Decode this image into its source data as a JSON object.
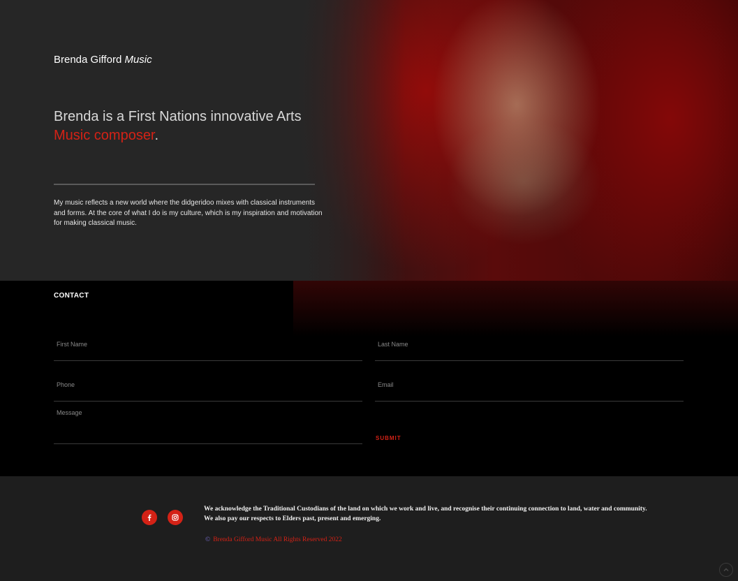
{
  "hero": {
    "brand_name": "Brenda Gifford",
    "brand_suffix": "Music",
    "headline_main": "Brenda is a First Nations innovative Arts",
    "headline_accent": "Music composer",
    "headline_end": ".",
    "intro": "My music reflects a new world where the didgeridoo mixes with classical instruments and forms. At the core of what I do is my culture, which is my inspiration and motivation for making classical music."
  },
  "contact": {
    "title": "CONTACT",
    "fields": {
      "first_name": {
        "placeholder": "First Name",
        "value": ""
      },
      "last_name": {
        "placeholder": "Last Name",
        "value": ""
      },
      "phone": {
        "placeholder": "Phone",
        "value": ""
      },
      "email": {
        "placeholder": "Email",
        "value": ""
      },
      "message": {
        "placeholder": "Message",
        "value": ""
      }
    },
    "submit_label": "SUBMIT"
  },
  "footer": {
    "social": [
      {
        "name": "facebook-icon"
      },
      {
        "name": "instagram-icon"
      }
    ],
    "acknowledgement_line1": "We acknowledge the Traditional Custodians of the land on which we work and live, and recognise their continuing connection to land, water and community.",
    "acknowledgement_line2": "We also pay our respects to Elders past, present and emerging.",
    "copyright_symbol": "©",
    "copyright_text": "Brenda Gifford Music All Rights Reserved 2022"
  },
  "colors": {
    "accent": "#d42216",
    "hero_bg": "#262626",
    "contact_bg": "#000000",
    "footer_bg": "#1e1e1e"
  }
}
